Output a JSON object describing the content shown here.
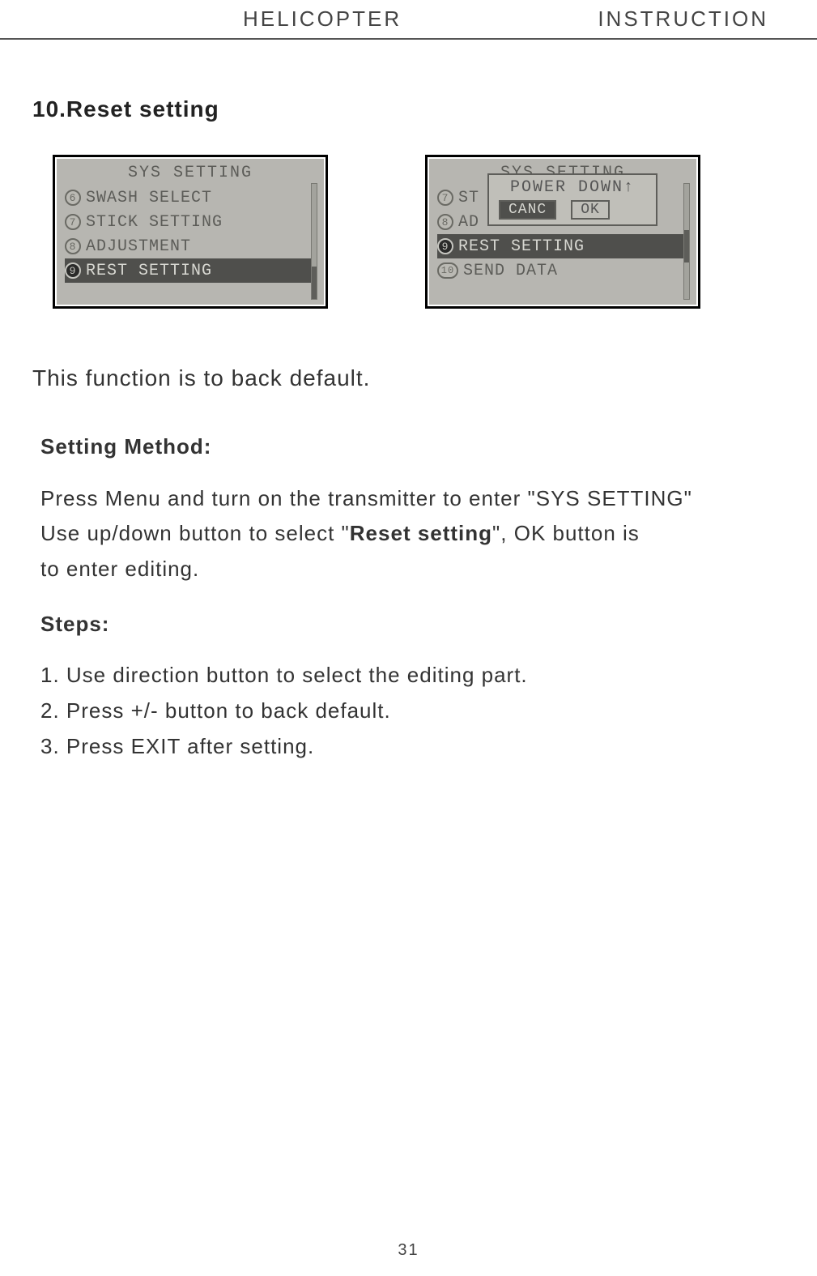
{
  "header": {
    "left": "HELICOPTER",
    "right": "INSTRUCTION"
  },
  "section_title": "10.Reset setting",
  "lcd1": {
    "title": "SYS SETTING",
    "items": [
      {
        "num": "6",
        "label": "SWASH SELECT",
        "selected": false
      },
      {
        "num": "7",
        "label": "STICK SETTING",
        "selected": false
      },
      {
        "num": "8",
        "label": "ADJUSTMENT",
        "selected": false
      },
      {
        "num": "9",
        "label": "REST SETTING",
        "selected": true
      }
    ]
  },
  "lcd2": {
    "title": "SYS SETTING",
    "items": [
      {
        "num": "7",
        "label": "ST",
        "selected": false
      },
      {
        "num": "8",
        "label": "AD",
        "selected": false
      },
      {
        "num": "9",
        "label": "REST SETTING",
        "selected": true
      },
      {
        "num": "10",
        "label": "SEND DATA",
        "selected": false
      }
    ],
    "overlay": {
      "title": "POWER DOWN↑",
      "buttons": [
        {
          "label": "CANC",
          "selected": true
        },
        {
          "label": "OK",
          "selected": false
        }
      ]
    }
  },
  "intro": "This function is to back default.",
  "method": {
    "heading": "Setting Method:",
    "line1_a": "Press Menu and turn on the transmitter to enter \"SYS SETTING\"",
    "line2_a": "Use up/down button to select \"",
    "line2_bold": "Reset setting",
    "line2_b": "\", OK button is",
    "line3": "to enter editing."
  },
  "steps": {
    "heading": "Steps:",
    "items": [
      "1. Use direction button to select the editing part.",
      "2. Press +/- button to back default.",
      "3. Press EXIT after setting."
    ]
  },
  "page_number": "31"
}
